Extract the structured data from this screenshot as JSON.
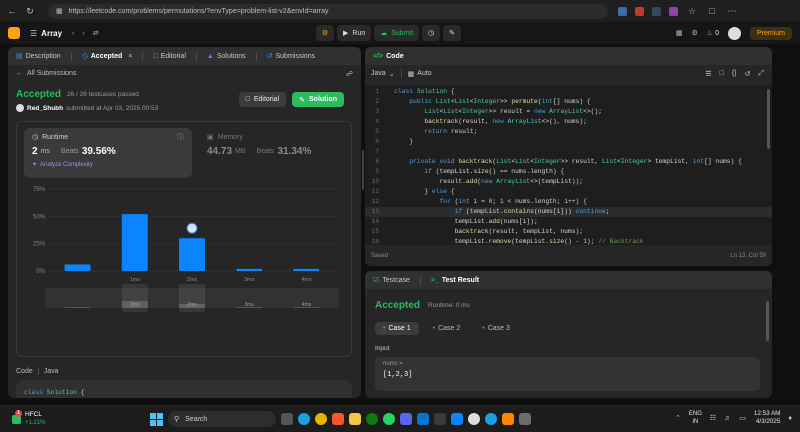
{
  "browser": {
    "url": "https://leetcode.com/problems/permutations/?envType=problem-list-v2&envId=array"
  },
  "topbar": {
    "problem_list": "Array",
    "run_label": "Run",
    "submit_label": "Submit",
    "fire_count": "0",
    "premium_label": "Premium"
  },
  "left": {
    "tabs": [
      "Description",
      "Accepted",
      "Editorial",
      "Solutions",
      "Submissions"
    ],
    "all_submissions": "All Submissions",
    "status": "Accepted",
    "testcases": "26 / 26 testcases passed",
    "user": "Red_Shubh",
    "submitted": "submitted at Apr 03, 2025 00:53",
    "editorial_btn": "Editorial",
    "solution_btn": "Solution",
    "runtime_label": "Runtime",
    "runtime_value": "2",
    "runtime_unit": "ms",
    "beats_label": "Beats",
    "runtime_beats": "39.56%",
    "analyze": "Analyze Complexity",
    "memory_label": "Memory",
    "memory_value": "44.73",
    "memory_unit": "MB",
    "memory_beats": "31.34%",
    "code_label": "Code",
    "lang_label": "Java",
    "code_lines": [
      "class Solution {",
      "    public List<List<Integer>> permute(int[] nums) {",
      "        List<List<Integer>> result = new ArrayList<>();",
      "        backtrack(result, new ArrayList<>(), nums);",
      "        return result;",
      "    }"
    ]
  },
  "chart_data": {
    "type": "bar",
    "categories": [
      "0ms",
      "1ms",
      "2ms",
      "3ms",
      "4ms"
    ],
    "tick_labels": [
      "",
      "1ms",
      "2ms",
      "3ms",
      "4ms"
    ],
    "values": [
      6,
      52,
      30,
      2,
      2
    ],
    "ylim": [
      0,
      75
    ],
    "yticks": [
      "0%",
      "25%",
      "50%",
      "75%"
    ],
    "highlight_category": "2ms",
    "bar_color": "#0a84ff"
  },
  "editor": {
    "title": "Code",
    "lang": "Java",
    "auto": "Auto",
    "saved": "Saved",
    "cursor": "Ln 13, Col 59",
    "line_numbers": [
      "1",
      "2",
      "3",
      "4",
      "5",
      "6",
      "7",
      "8",
      "9",
      "10",
      "11",
      "12",
      "13",
      "14",
      "15",
      "16",
      "17"
    ],
    "lines": [
      "class Solution {",
      "    public List<List<Integer>> permute(int[] nums) {",
      "        List<List<Integer>> result = new ArrayList<>();",
      "        backtrack(result, new ArrayList<>(), nums);",
      "        return result;",
      "    }",
      "",
      "    private void backtrack(List<List<Integer>> result, List<Integer> tempList, int[] nums) {",
      "        if (tempList.size() == nums.length) {",
      "            result.add(new ArrayList<>(tempList));",
      "        } else {",
      "            for (int i = 0; i < nums.length; i++) {",
      "                if (tempList.contains(nums[i])) continue;",
      "                tempList.add(nums[i]);",
      "                backtrack(result, tempList, nums);",
      "                tempList.remove(tempList.size() - 1); // Backtrack",
      "            }"
    ]
  },
  "result": {
    "tab_testcase": "Testcase",
    "tab_result": "Test Result",
    "status": "Accepted",
    "runtime": "Runtime: 0 ms",
    "cases": [
      "Case 1",
      "Case 2",
      "Case 3"
    ],
    "input_label": "Input",
    "param_name": "nums =",
    "param_value": "[1,2,3]"
  },
  "taskbar": {
    "weather_temp": "HFCL",
    "weather_change": "+1.21%",
    "weather_badge": "1",
    "search_placeholder": "Search",
    "lang": "ENG",
    "region": "IN",
    "time": "12:53 AM",
    "date": "4/3/2025"
  },
  "colors": {
    "accent_green": "#2cbb5d",
    "premium": "#ffa116",
    "bar_blue": "#0a84ff"
  }
}
